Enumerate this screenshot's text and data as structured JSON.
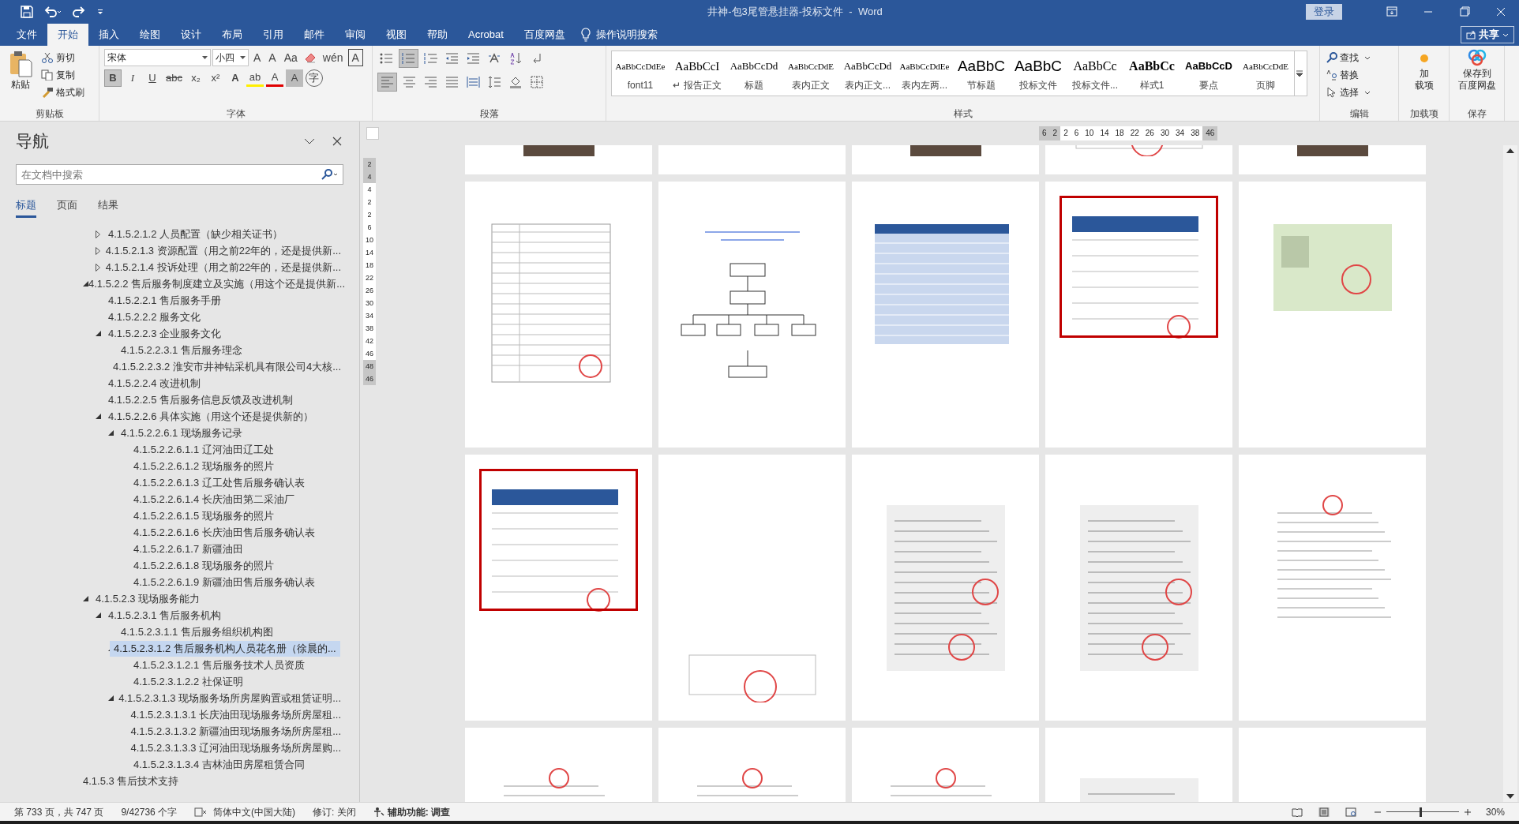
{
  "title_bar": {
    "title": "井神-包3尾管悬挂器-投标文件  -  Word",
    "sign_in": "登录"
  },
  "tabs": [
    {
      "label": "文件",
      "selected": false
    },
    {
      "label": "开始",
      "selected": true
    },
    {
      "label": "插入",
      "selected": false
    },
    {
      "label": "绘图",
      "selected": false
    },
    {
      "label": "设计",
      "selected": false
    },
    {
      "label": "布局",
      "selected": false
    },
    {
      "label": "引用",
      "selected": false
    },
    {
      "label": "邮件",
      "selected": false
    },
    {
      "label": "审阅",
      "selected": false
    },
    {
      "label": "视图",
      "selected": false
    },
    {
      "label": "帮助",
      "selected": false
    },
    {
      "label": "Acrobat",
      "selected": false
    },
    {
      "label": "百度网盘",
      "selected": false
    }
  ],
  "tell_me": "操作说明搜索",
  "share": "共享",
  "ribbon": {
    "clipboard": {
      "label": "剪贴板",
      "paste": "粘贴",
      "cut": "剪切",
      "copy": "复制",
      "format_painter": "格式刷"
    },
    "font": {
      "label": "字体",
      "font_name": "宋体",
      "font_size": "小四",
      "row1": [
        {
          "kind": "grow",
          "label": "A"
        },
        {
          "kind": "shrink",
          "label": "A"
        },
        {
          "kind": "case",
          "label": "Aa"
        },
        {
          "kind": "clear"
        },
        {
          "kind": "phonetic",
          "label": "wén"
        },
        {
          "kind": "border",
          "label": "A"
        }
      ],
      "row2": [
        {
          "kind": "bold",
          "label": "B",
          "on": true
        },
        {
          "kind": "italic",
          "label": "I",
          "on": false
        },
        {
          "kind": "underline",
          "label": "U",
          "on": false
        },
        {
          "kind": "strike",
          "label": "abc",
          "on": false
        },
        {
          "kind": "sub",
          "label": "x₂",
          "on": false
        },
        {
          "kind": "sup",
          "label": "x²",
          "on": false
        },
        {
          "kind": "effect",
          "label": "A",
          "on": false
        },
        {
          "kind": "highlight",
          "label": "ab",
          "on": false
        },
        {
          "kind": "color",
          "label": "A",
          "on": false
        },
        {
          "kind": "shading",
          "label": "A",
          "on": false
        },
        {
          "kind": "enclose",
          "label": "字",
          "on": false
        }
      ]
    },
    "paragraph": {
      "label": "段落",
      "row1": [
        {
          "kind": "bullets",
          "on": false
        },
        {
          "kind": "numbering",
          "on": true
        },
        {
          "kind": "multilevel",
          "on": false
        },
        {
          "kind": "outdent",
          "on": false
        },
        {
          "kind": "indent",
          "on": false
        },
        {
          "kind": "asian",
          "on": false
        },
        {
          "kind": "sort",
          "on": false
        },
        {
          "kind": "marks",
          "on": false
        }
      ],
      "row2": [
        {
          "kind": "left",
          "on": true
        },
        {
          "kind": "center",
          "on": false
        },
        {
          "kind": "right",
          "on": false
        },
        {
          "kind": "justify",
          "on": false
        },
        {
          "kind": "distribute",
          "on": false
        },
        {
          "kind": "spacing",
          "on": false
        },
        {
          "kind": "fill",
          "on": false
        },
        {
          "kind": "borders",
          "on": false
        }
      ]
    },
    "styles": {
      "label": "样式",
      "items": [
        {
          "preview": "AaBbCcDdEe",
          "name": "font11",
          "kind": "small"
        },
        {
          "preview": "AaBbCcI",
          "name": "↵ 报告正文",
          "kind": "serif"
        },
        {
          "preview": "AaBbCcDd",
          "name": "标题",
          "kind": "normal"
        },
        {
          "preview": "AaBbCcDdE",
          "name": "表内正文",
          "kind": "small"
        },
        {
          "preview": "AaBbCcDd",
          "name": "表内正文...",
          "kind": "normal"
        },
        {
          "preview": "AaBbCcDdEe",
          "name": "表内左两...",
          "kind": "small"
        },
        {
          "preview": "AaBbC",
          "name": "节标题",
          "kind": "large"
        },
        {
          "preview": "AaBbC",
          "name": "投标文件",
          "kind": "large"
        },
        {
          "preview": "AaBbCc",
          "name": "投标文件...",
          "kind": "medium"
        },
        {
          "preview": "AaBbCc",
          "name": "样式1",
          "kind": "bold"
        },
        {
          "preview": "AaBbCcD",
          "name": "要点",
          "kind": "boldsans"
        },
        {
          "preview": "AaBbCcDdE",
          "name": "页脚",
          "kind": "small"
        }
      ]
    },
    "editing": {
      "label": "编辑",
      "find": "查找",
      "replace": "替换",
      "select": "选择"
    },
    "addins": {
      "label": "加载项",
      "button": [
        "加",
        "载项"
      ]
    },
    "save": {
      "label": "保存",
      "button": [
        "保存到",
        "百度网盘"
      ]
    }
  },
  "navigation": {
    "title": "导航",
    "search": {
      "placeholder": "在文档中搜索"
    },
    "tabs": [
      {
        "label": "标题",
        "selected": true
      },
      {
        "label": "页面",
        "selected": false
      },
      {
        "label": "结果",
        "selected": false
      }
    ],
    "headings": [
      {
        "children": [
          {
            "children": [
              {
                "label": "4.1.5.2.1.2 人员配置（缺少相关证书）",
                "expanded": false,
                "selected": false
              },
              {
                "label": "4.1.5.2.1.3 资源配置（用之前22年的，还是提供新...",
                "expanded": false,
                "selected": false
              },
              {
                "label": "4.1.5.2.1.4 投诉处理（用之前22年的，还是提供新...",
                "expanded": false,
                "selected": false
              }
            ]
          },
          {
            "label": "4.1.5.2.2 售后服务制度建立及实施（用这个还是提供新...",
            "expanded": true,
            "selected": false,
            "children": [
              {
                "label": "4.1.5.2.2.1 售后服务手册",
                "selected": false
              },
              {
                "label": "4.1.5.2.2.2 服务文化",
                "selected": false
              },
              {
                "label": "4.1.5.2.2.3 企业服务文化",
                "expanded": true,
                "selected": false,
                "children": [
                  {
                    "label": "4.1.5.2.2.3.1 售后服务理念",
                    "selected": false
                  },
                  {
                    "label": "4.1.5.2.2.3.2 淮安市井神钻采机具有限公司4大核...",
                    "selected": false
                  }
                ]
              },
              {
                "label": "4.1.5.2.2.4 改进机制",
                "selected": false
              },
              {
                "label": "4.1.5.2.2.5 售后服务信息反馈及改进机制",
                "selected": false
              },
              {
                "label": "4.1.5.2.2.6 具体实施（用这个还是提供新的）",
                "expanded": true,
                "selected": false,
                "children": [
                  {
                    "label": "4.1.5.2.2.6.1 现场服务记录",
                    "expanded": true,
                    "selected": false,
                    "children": [
                      {
                        "label": "4.1.5.2.2.6.1.1 辽河油田辽工处",
                        "selected": false
                      },
                      {
                        "label": "4.1.5.2.2.6.1.2 现场服务的照片",
                        "selected": false
                      },
                      {
                        "label": "4.1.5.2.2.6.1.3 辽工处售后服务确认表",
                        "selected": false
                      },
                      {
                        "label": "4.1.5.2.2.6.1.4 长庆油田第二采油厂",
                        "selected": false
                      },
                      {
                        "label": "4.1.5.2.2.6.1.5 现场服务的照片",
                        "selected": false
                      },
                      {
                        "label": "4.1.5.2.2.6.1.6 长庆油田售后服务确认表",
                        "selected": false
                      },
                      {
                        "label": "4.1.5.2.2.6.1.7 新疆油田",
                        "selected": false
                      },
                      {
                        "label": "4.1.5.2.2.6.1.8 现场服务的照片",
                        "selected": false
                      },
                      {
                        "label": "4.1.5.2.2.6.1.9 新疆油田售后服务确认表",
                        "selected": false
                      }
                    ]
                  }
                ]
              }
            ]
          },
          {
            "label": "4.1.5.2.3 现场服务能力",
            "expanded": true,
            "selected": false,
            "children": [
              {
                "label": "4.1.5.2.3.1 售后服务机构",
                "expanded": true,
                "selected": false,
                "children": [
                  {
                    "label": "4.1.5.2.3.1.1 售后服务组织机构图",
                    "selected": false
                  },
                  {
                    "label": "4.1.5.2.3.1.2 售后服务机构人员花名册（徐晨的...",
                    "expanded": true,
                    "selected": true,
                    "children": [
                      {
                        "label": "4.1.5.2.3.1.2.1 售后服务技术人员资质",
                        "selected": false
                      },
                      {
                        "label": "4.1.5.2.3.1.2.2 社保证明",
                        "selected": false
                      }
                    ]
                  },
                  {
                    "label": "4.1.5.2.3.1.3 现场服务场所房屋购置或租赁证明...",
                    "expanded": true,
                    "selected": false,
                    "children": [
                      {
                        "label": "4.1.5.2.3.1.3.1 长庆油田现场服务场所房屋租...",
                        "selected": false
                      },
                      {
                        "label": "4.1.5.2.3.1.3.2 新疆油田现场服务场所房屋租...",
                        "selected": false
                      },
                      {
                        "label": "4.1.5.2.3.1.3.3 辽河油田现场服务场所房屋购...",
                        "selected": false
                      },
                      {
                        "label": "4.1.5.2.3.1.3.4 吉林油田房屋租赁合同",
                        "selected": false
                      }
                    ]
                  }
                ]
              }
            ]
          }
        ]
      },
      {
        "label": "4.1.5.3 售后技术支持",
        "selected": false
      }
    ]
  },
  "ruler": [
    {
      "label": "6",
      "margin": true
    },
    {
      "label": "2",
      "margin": true
    },
    {
      "label": "2",
      "margin": false
    },
    {
      "label": "6",
      "margin": false
    },
    {
      "label": "10",
      "margin": false
    },
    {
      "label": "14",
      "margin": false
    },
    {
      "label": "18",
      "margin": false
    },
    {
      "label": "22",
      "margin": false
    },
    {
      "label": "26",
      "margin": false
    },
    {
      "label": "30",
      "margin": false
    },
    {
      "label": "34",
      "margin": false
    },
    {
      "label": "38",
      "margin": false
    },
    {
      "label": "46",
      "margin": true
    }
  ],
  "vertical_ruler": [
    {
      "label": "2",
      "margin": true
    },
    {
      "label": "4",
      "margin": true
    },
    {
      "label": "4",
      "margin": false
    },
    {
      "label": "2",
      "margin": false
    },
    {
      "label": "2",
      "margin": false
    },
    {
      "label": "6",
      "margin": false
    },
    {
      "label": "10",
      "margin": false
    },
    {
      "label": "14",
      "margin": false
    },
    {
      "label": "18",
      "margin": false
    },
    {
      "label": "22",
      "margin": false
    },
    {
      "label": "26",
      "margin": false
    },
    {
      "label": "30",
      "margin": false
    },
    {
      "label": "34",
      "margin": false
    },
    {
      "label": "38",
      "margin": false
    },
    {
      "label": "42",
      "margin": false
    },
    {
      "label": "46",
      "margin": false
    },
    {
      "label": "48",
      "margin": true
    },
    {
      "label": "46",
      "margin": true
    }
  ],
  "pages": [
    {
      "kind": "photo"
    },
    {
      "kind": "blank"
    },
    {
      "kind": "photo"
    },
    {
      "kind": "stamp"
    },
    {
      "kind": "photo"
    },
    {
      "kind": "form",
      "highlighted": false
    },
    {
      "kind": "org-chart",
      "highlighted": false
    },
    {
      "kind": "table",
      "highlighted": false
    },
    {
      "kind": "roster",
      "highlighted": true
    },
    {
      "kind": "certificate",
      "highlighted": false
    },
    {
      "kind": "roster",
      "highlighted": true
    },
    {
      "kind": "stamp",
      "highlighted": false
    },
    {
      "kind": "scan",
      "highlighted": false
    },
    {
      "kind": "scan",
      "highlighted": false
    },
    {
      "kind": "letter",
      "highlighted": false
    },
    {
      "kind": "letter",
      "highlighted": false
    },
    {
      "kind": "letter",
      "highlighted": false
    },
    {
      "kind": "letter",
      "highlighted": false
    },
    {
      "kind": "scan",
      "highlighted": false
    },
    {
      "kind": "photo",
      "highlighted": false
    }
  ],
  "status_bar": {
    "page": "第 733 页，共 747 页",
    "words": "9/42736 个字",
    "language": "简体中文(中国大陆)",
    "track_changes": "修订: 关闭",
    "accessibility": "辅助功能: 调查",
    "zoom": {
      "level": 0.47,
      "reading": "30%"
    }
  }
}
